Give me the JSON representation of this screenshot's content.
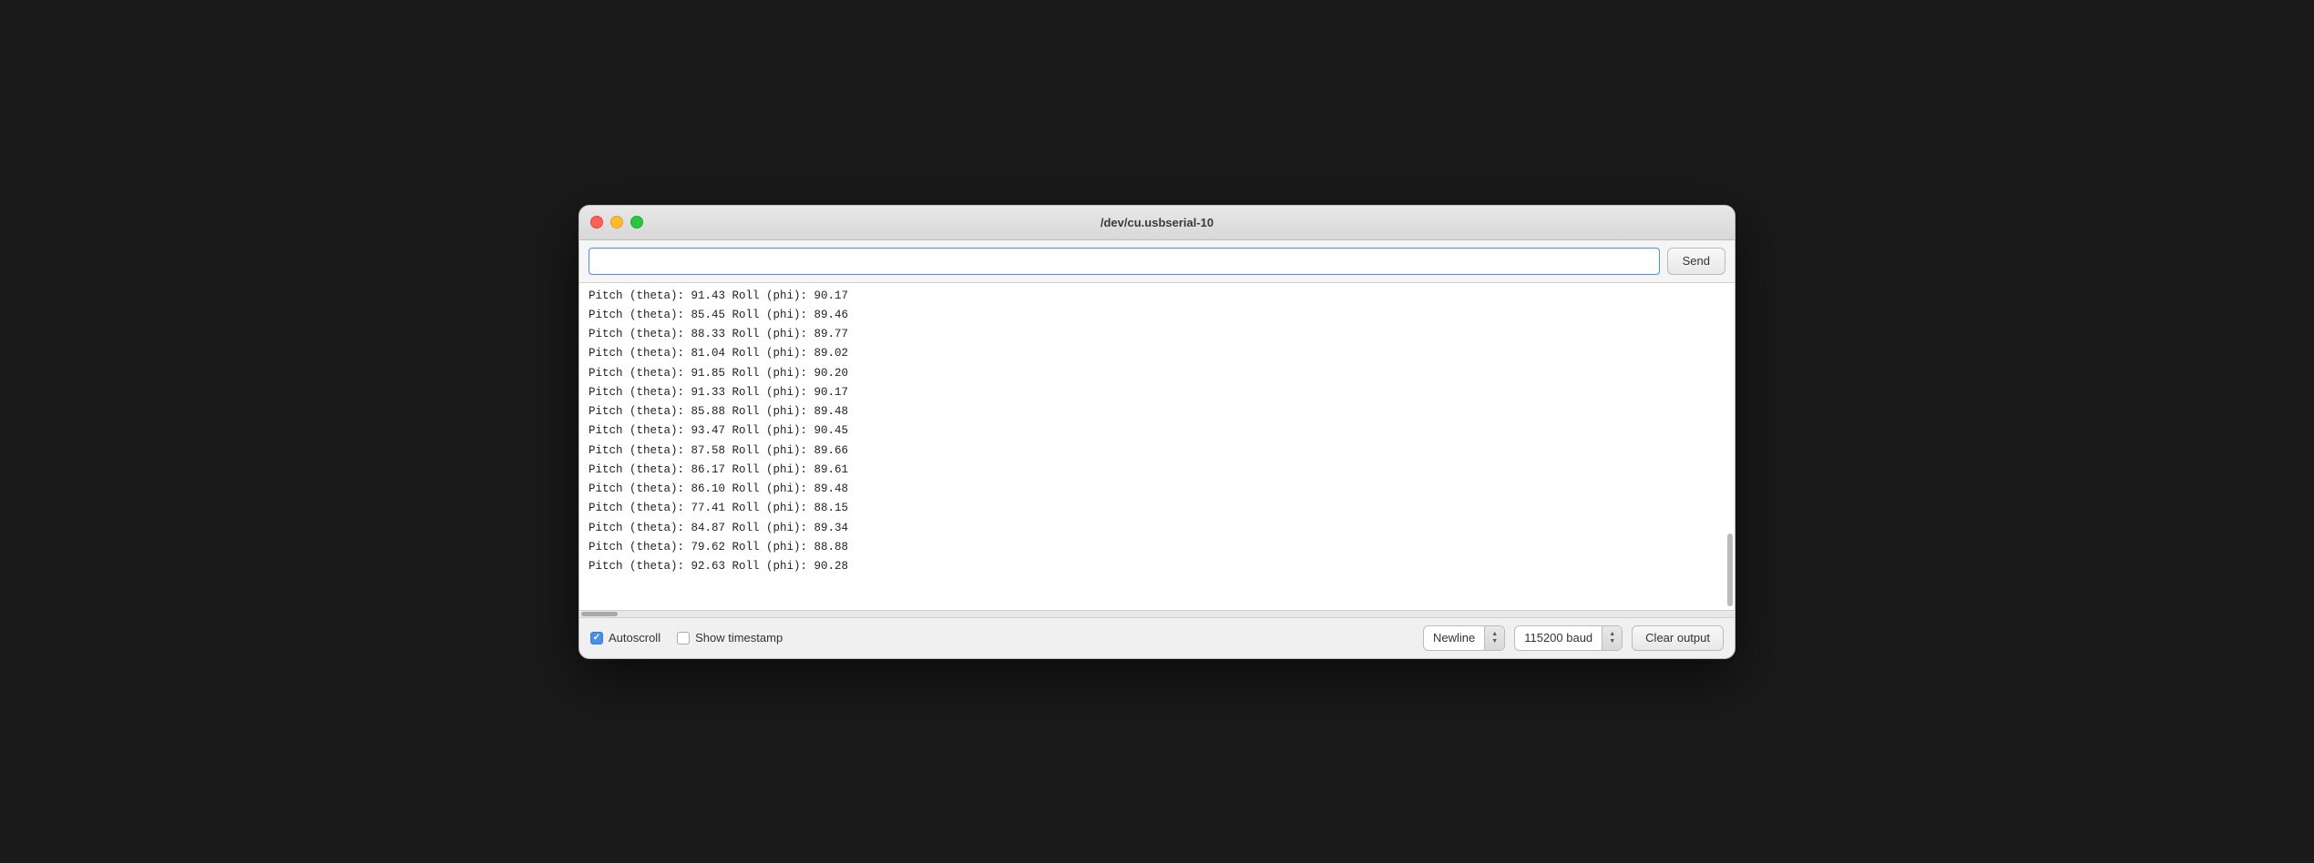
{
  "window": {
    "title": "/dev/cu.usbserial-10"
  },
  "toolbar": {
    "send_input_placeholder": "",
    "send_button_label": "Send"
  },
  "output": {
    "lines": [
      "Pitch (theta): 91.43 Roll (phi): 90.17",
      "Pitch (theta): 85.45 Roll (phi): 89.46",
      "Pitch (theta): 88.33 Roll (phi): 89.77",
      "Pitch (theta): 81.04 Roll (phi): 89.02",
      "Pitch (theta): 91.85 Roll (phi): 90.20",
      "Pitch (theta): 91.33 Roll (phi): 90.17",
      "Pitch (theta): 85.88 Roll (phi): 89.48",
      "Pitch (theta): 93.47 Roll (phi): 90.45",
      "Pitch (theta): 87.58 Roll (phi): 89.66",
      "Pitch (theta): 86.17 Roll (phi): 89.61",
      "Pitch (theta): 86.10 Roll (phi): 89.48",
      "Pitch (theta): 77.41 Roll (phi): 88.15",
      "Pitch (theta): 84.87 Roll (phi): 89.34",
      "Pitch (theta): 79.62 Roll (phi): 88.88",
      "Pitch (theta): 92.63 Roll (phi): 90.28"
    ]
  },
  "statusbar": {
    "autoscroll_label": "Autoscroll",
    "autoscroll_checked": true,
    "show_timestamp_label": "Show timestamp",
    "show_timestamp_checked": false,
    "newline_label": "Newline",
    "baud_rate_label": "115200 baud",
    "clear_output_label": "Clear output"
  },
  "colors": {
    "accent": "#4a90e2",
    "checkbox_checked": "#4a90e2"
  }
}
